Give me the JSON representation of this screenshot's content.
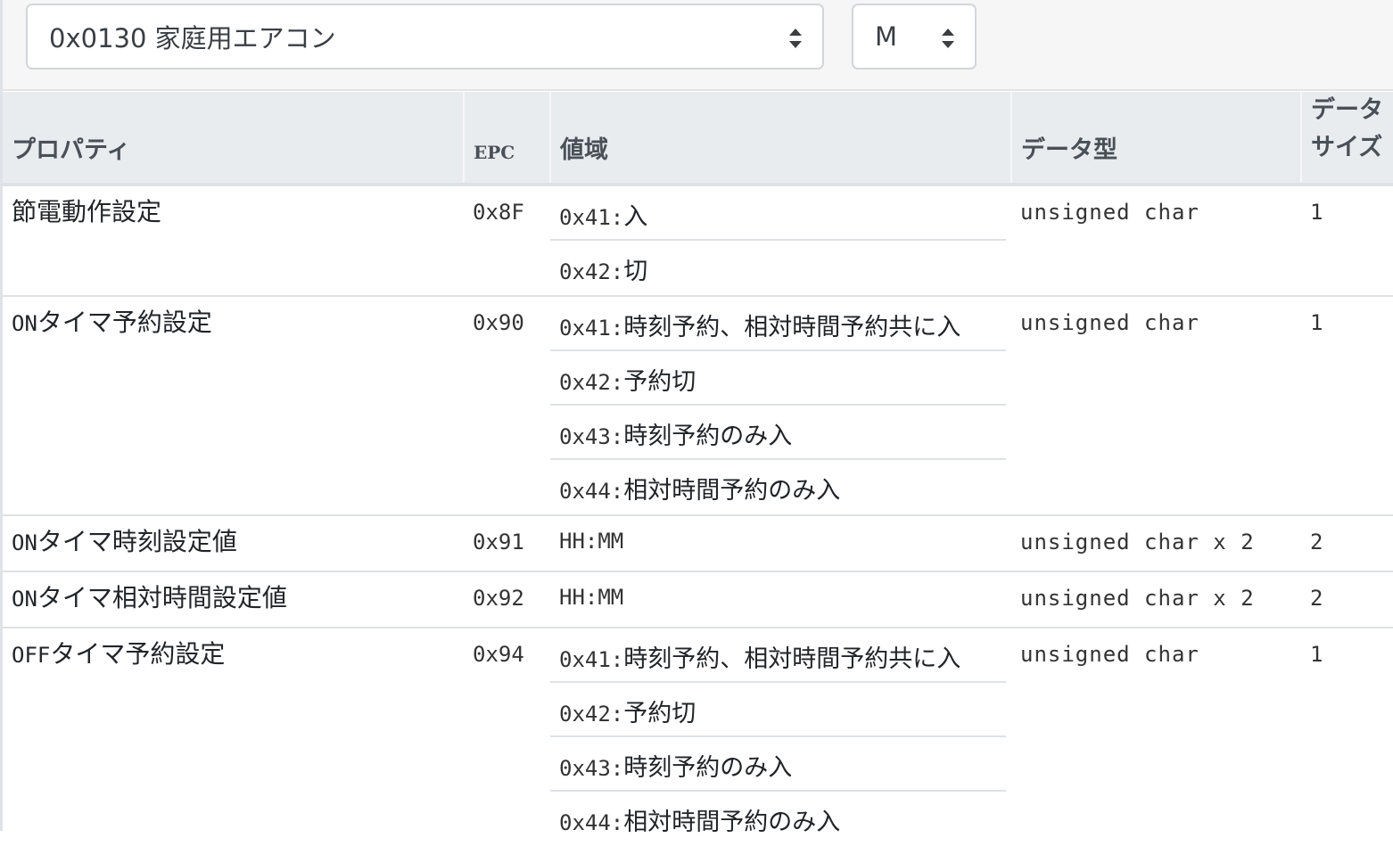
{
  "toolbar": {
    "device_select": "0x0130 家庭用エアコン",
    "mode_select": "M"
  },
  "table": {
    "headers": {
      "property": "プロパティ",
      "epc": "EPC",
      "range": "値域",
      "type": "データ型",
      "size_line1": "データ",
      "size_line2": "サイズ"
    },
    "rows": [
      {
        "name_prefix": "",
        "name": "節電動作設定",
        "epc": "0x8F",
        "values": [
          {
            "code": "0x41:",
            "text": "入"
          },
          {
            "code": "0x42:",
            "text": "切"
          }
        ],
        "type": "unsigned char",
        "size": "1"
      },
      {
        "name_prefix": "ON",
        "name": "タイマ予約設定",
        "epc": "0x90",
        "values": [
          {
            "code": "0x41:",
            "text": "時刻予約、相対時間予約共に入"
          },
          {
            "code": "0x42:",
            "text": "予約切"
          },
          {
            "code": "0x43:",
            "text": "時刻予約のみ入"
          },
          {
            "code": "0x44:",
            "text": "相対時間予約のみ入"
          }
        ],
        "type": "unsigned char",
        "size": "1"
      },
      {
        "name_prefix": "ON",
        "name": "タイマ時刻設定値",
        "epc": "0x91",
        "values": [
          {
            "code": "HH:MM",
            "text": ""
          }
        ],
        "type": "unsigned char x 2",
        "size": "2"
      },
      {
        "name_prefix": "ON",
        "name": "タイマ相対時間設定値",
        "epc": "0x92",
        "values": [
          {
            "code": "HH:MM",
            "text": ""
          }
        ],
        "type": "unsigned char x 2",
        "size": "2"
      },
      {
        "name_prefix": "OFF",
        "name": "タイマ予約設定",
        "epc": "0x94",
        "values": [
          {
            "code": "0x41:",
            "text": "時刻予約、相対時間予約共に入"
          },
          {
            "code": "0x42:",
            "text": "予約切"
          },
          {
            "code": "0x43:",
            "text": "時刻予約のみ入"
          },
          {
            "code": "0x44:",
            "text": "相対時間予約のみ入"
          }
        ],
        "type": "unsigned char",
        "size": "1"
      }
    ]
  }
}
